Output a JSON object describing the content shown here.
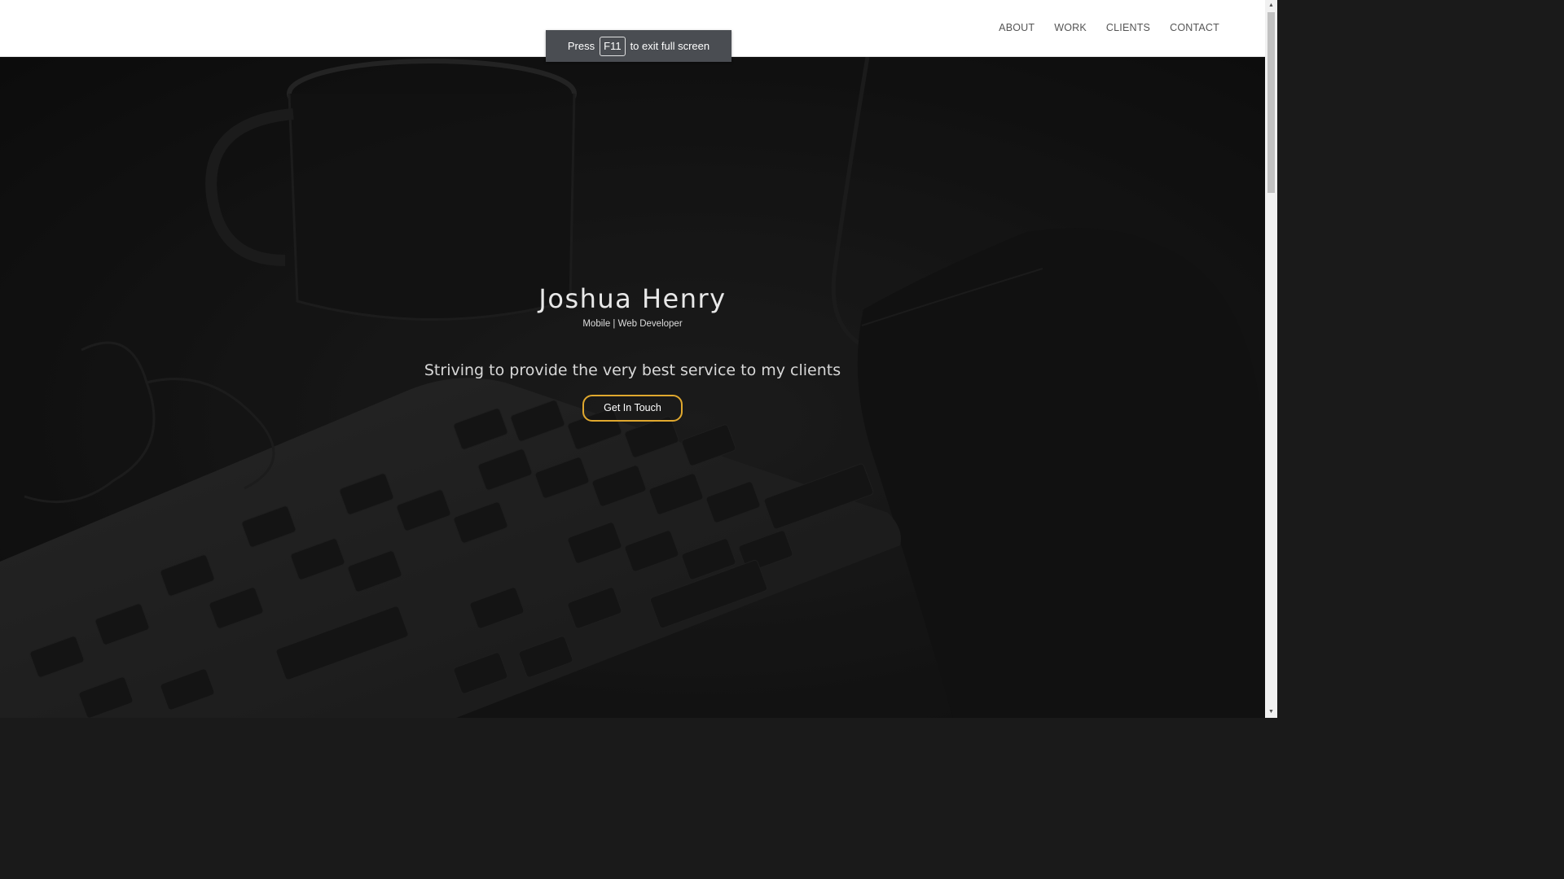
{
  "nav": {
    "items": [
      {
        "label": "ABOUT"
      },
      {
        "label": "WORK"
      },
      {
        "label": "CLIENTS"
      },
      {
        "label": "CONTACT"
      }
    ]
  },
  "fullscreen_toast": {
    "prefix": "Press",
    "key": "F11",
    "suffix": "to exit full screen"
  },
  "hero": {
    "title": "Joshua Henry",
    "subtitle": "Mobile | Web Developer",
    "tagline": "Striving to provide the very best service to my clients",
    "cta_label": "Get In Touch"
  },
  "colors": {
    "accent": "#e0a82e",
    "navbar_bg": "#ffffff",
    "nav_text": "#555555",
    "hero_overlay": "#151515",
    "toast_bg": "#4a4d52"
  },
  "icons": {
    "scroll_up": "scroll-up-arrow-icon",
    "scroll_down": "scroll-down-arrow-icon"
  }
}
